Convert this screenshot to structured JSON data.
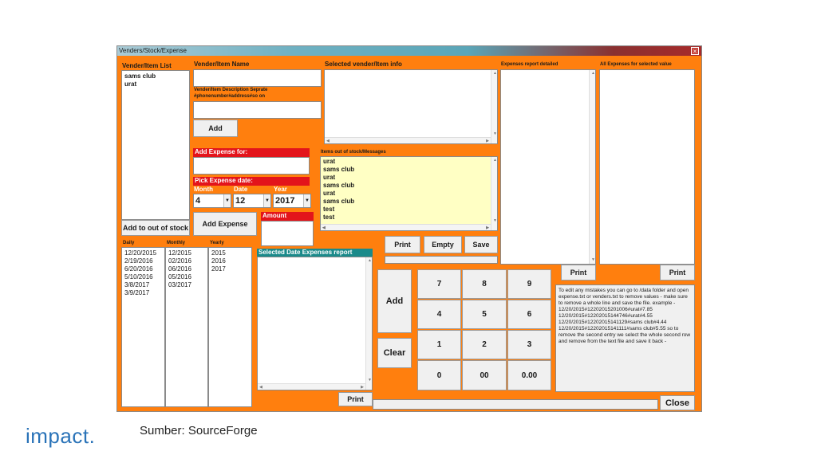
{
  "window": {
    "title": "Venders/Stock/Expense",
    "close_glyph": "×"
  },
  "vendor_list": {
    "label": "Vender/Item List",
    "items": [
      "sams club",
      "urat"
    ],
    "add_out_of_stock": "Add to out of stock"
  },
  "vendor_form": {
    "name_label": "Vender/Item Name",
    "name_value": "",
    "desc_label_1": "Vender/Item Description Seprate",
    "desc_label_2": "#phonenumber#address#so on",
    "desc_value": "",
    "add_button": "Add"
  },
  "selected_info": {
    "label": "Selected vender/Item info"
  },
  "expense_form": {
    "add_for_label": "Add Expense for:",
    "pick_date_label": "Pick Expense date:",
    "month_label": "Month",
    "date_label": "Date",
    "year_label": "Year",
    "month_value": "4",
    "date_value": "12",
    "year_value": "2017",
    "amount_label": "Amount",
    "add_expense_button": "Add Expense"
  },
  "stock_messages": {
    "label": "Items out of stock/Messages",
    "items": [
      "urat",
      "sams club",
      "urat",
      "sams club",
      "urat",
      "sams club",
      "test",
      "test"
    ],
    "print_button": "Print",
    "empty_button": "Empty",
    "save_button": "Save"
  },
  "date_lists": {
    "daily_header": "Daily",
    "monthly_header": "Monthly",
    "yearly_header": "Yearly",
    "daily": [
      "12/20/2015",
      "2/19/2016",
      "6/20/2016",
      "5/10/2016",
      "3/8/2017",
      "3/9/2017"
    ],
    "monthly": [
      "12/2015",
      "02/2016",
      "06/2016",
      "05/2016",
      "03/2017"
    ],
    "yearly": [
      "2015",
      "2016",
      "2017"
    ]
  },
  "date_report": {
    "label": "Selected Date Expenses report",
    "print_button": "Print"
  },
  "keypad": {
    "add_button": "Add",
    "clear_button": "Clear",
    "keys": [
      "7",
      "8",
      "9",
      "4",
      "5",
      "6",
      "1",
      "2",
      "3",
      "0",
      "00",
      "0.00"
    ]
  },
  "expenses_detailed": {
    "label": "Expenses report detailed",
    "print_button": "Print"
  },
  "all_expenses": {
    "label": "All Expenses for selected value",
    "print_button": "Print"
  },
  "help_note": {
    "text": "To edit any mistakes you can go to /data folder and open expense.txt or venders.txt to remove values - make sure to remove a whole line and save the file. example - 12/20/2015#1220201520100​6#urat#7.85 12/20/2015#1220201514474​6#urat#4.55 12/20/2015#1220201514112​9#sams club#4.44 12/20/2015#1220201514111​1#sams club#5.55 so to remove the second entry we select the whole second row and remove from the text file and save it back -"
  },
  "close_button": "Close",
  "footer": {
    "brand": "impact",
    "brand_dot": ".",
    "source": "Sumber: SourceForge"
  }
}
